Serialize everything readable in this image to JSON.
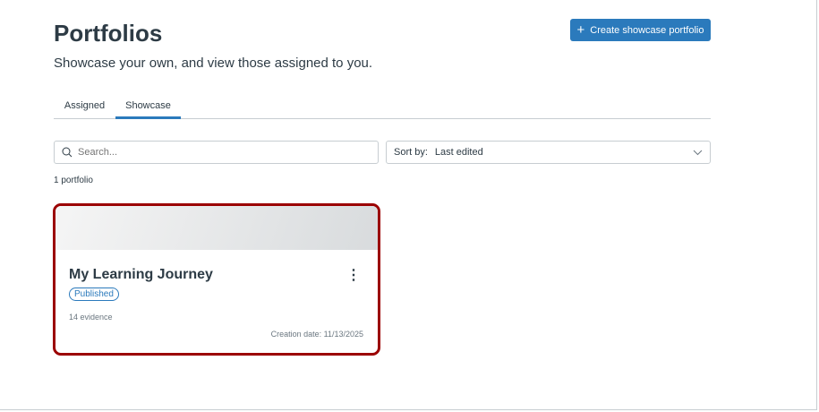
{
  "header": {
    "title": "Portfolios",
    "subtitle": "Showcase your own, and view those assigned to you.",
    "create_button": "Create showcase portfolio"
  },
  "tabs": [
    {
      "label": "Assigned"
    },
    {
      "label": "Showcase",
      "active": true
    }
  ],
  "search": {
    "placeholder": "Search...",
    "value": ""
  },
  "sort": {
    "label": "Sort by:",
    "value": "Last edited"
  },
  "count": "1 portfolio",
  "portfolios": [
    {
      "title": "My Learning Journey",
      "status": "Published",
      "evidence": "14 evidence",
      "creation_date": "Creation date: 11/13/2025"
    }
  ],
  "colors": {
    "accent": "#2b7abc",
    "card_border": "#9b0000"
  }
}
